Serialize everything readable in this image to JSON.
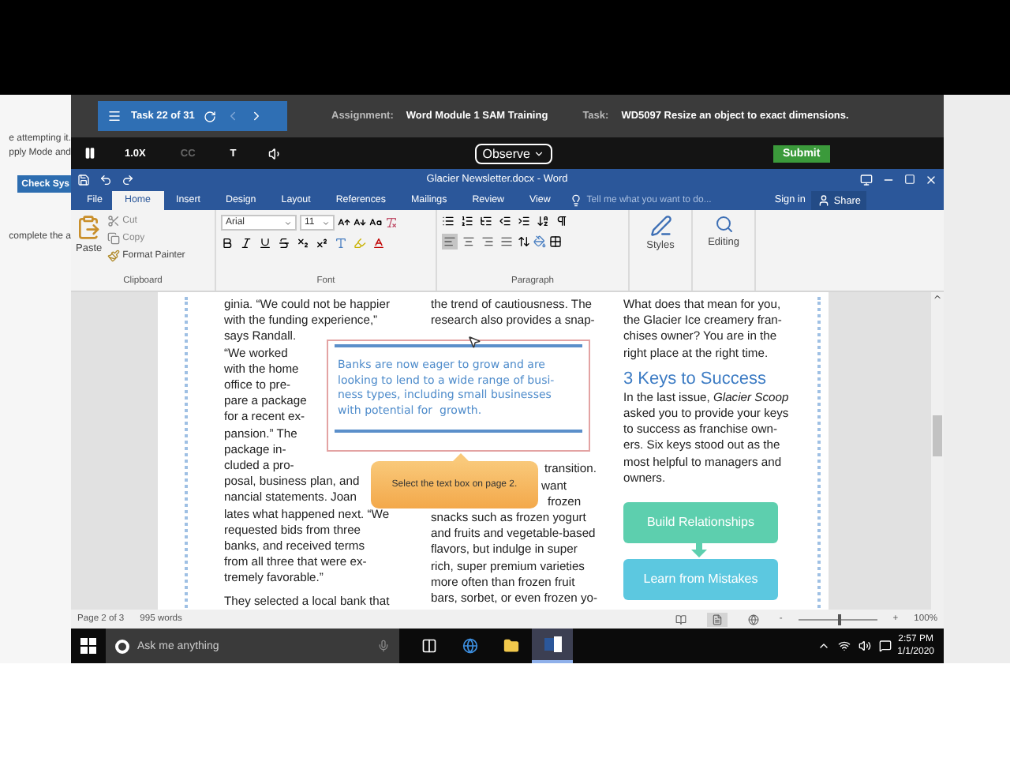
{
  "background_page": {
    "lines": [
      "e attempting it.",
      "pply Mode and"
    ],
    "button": "Check Sys",
    "note": "complete the a"
  },
  "sam_bar": {
    "task_counter": "Task 22 of 31",
    "prev_disabled": true,
    "next_disabled": false,
    "assignment_label": "Assignment:",
    "assignment": "Word Module 1 SAM Training",
    "task_label": "Task:",
    "task": "WD5097 Resize an object to exact dimensions."
  },
  "player": {
    "speed": "1.0X",
    "captions": {
      "label": "CC",
      "disabled": true
    },
    "text_toggle": "T",
    "mode": "Observe",
    "submit": "Submit"
  },
  "word": {
    "title": "Glacier Newsletter.docx - Word",
    "tabs": [
      {
        "label": "File",
        "selected": false
      },
      {
        "label": "Home",
        "selected": true
      },
      {
        "label": "Insert",
        "selected": false
      },
      {
        "label": "Design",
        "selected": false
      },
      {
        "label": "Layout",
        "selected": false
      },
      {
        "label": "References",
        "selected": false
      },
      {
        "label": "Mailings",
        "selected": false
      },
      {
        "label": "Review",
        "selected": false
      },
      {
        "label": "View",
        "selected": false
      }
    ],
    "tell_me": {
      "placeholder": "Tell me what you want to do..."
    },
    "sign_in": "Sign in",
    "share": "Share"
  },
  "ribbon": {
    "clipboard": {
      "paste": "Paste",
      "cut": "Cut",
      "copy": "Copy",
      "format_painter": "Format Painter",
      "label": "Clipboard"
    },
    "font": {
      "name": "Arial",
      "size": "11",
      "label": "Font"
    },
    "paragraph": {
      "label": "Paragraph",
      "alignments": [
        {
          "kind": "left",
          "selected": true
        },
        {
          "kind": "center",
          "selected": false
        },
        {
          "kind": "right",
          "selected": false
        },
        {
          "kind": "justify",
          "selected": false
        }
      ]
    },
    "styles": "Styles",
    "editing": "Editing"
  },
  "document": {
    "left_column": {
      "blocks": [
        [
          "ginia. “We could not be happier",
          "with the funding experience,”",
          "says Randall."
        ],
        [
          "“We worked",
          "with the home",
          "office to pre-",
          "pare a package",
          "for a recent ex-",
          "pansion.” The",
          "package in-",
          "cluded a pro-"
        ],
        [
          "posal, business plan, and",
          "nancial statements. Joan",
          "lates what happened next. “We",
          "requested bids from three",
          "banks, and received terms",
          "from all three that were ex-",
          "tremely favorable.”"
        ]
      ],
      "next": "They selected a local bank that"
    },
    "middle_column": {
      "lines": [
        "the trend of cautiousness. The",
        "research also provides a snap-"
      ],
      "fragments": [
        "transition.",
        "want",
        "frozen"
      ],
      "lines_after": [
        "snacks such as frozen yogurt",
        "and fruits and vegetable-based",
        "flavors, but indulge in super",
        "rich, super premium varieties",
        "more often than frozen fruit",
        "bars, sorbet, or even frozen yo-"
      ]
    },
    "right_column": {
      "lines": [
        "What does that mean for you,",
        "the Glacier Ice creamery fran-",
        "chises owner? You are in the",
        "right place at the right time."
      ],
      "heading": "3 Keys to Success",
      "body": [
        "In the last issue, *Glacier Scoop*",
        "asked you to provide your keys",
        "to success as franchise own-",
        "ers. Six keys stood out as the",
        "most helpful to managers and",
        "owners."
      ],
      "steps": [
        {
          "label": "Build Relationships",
          "color": "#5dcfae"
        },
        {
          "label": "Learn from Mistakes",
          "color": "#5cc8e0"
        }
      ]
    },
    "text_box": {
      "lines": [
        "Banks are now eager to grow and are",
        "looking to lend to a wide range of busi-",
        "ness types, including small businesses",
        "with potential for  growth."
      ]
    },
    "tooltip": "Select the text box on page 2."
  },
  "status_bar": {
    "page": "Page 2 of 3",
    "words": "995 words",
    "views": [
      {
        "kind": "read",
        "selected": false
      },
      {
        "kind": "print",
        "selected": true
      },
      {
        "kind": "web",
        "selected": false
      }
    ],
    "zoom": {
      "minus": "-",
      "plus": "+",
      "level": 0.5,
      "reading": "100%"
    }
  },
  "taskbar": {
    "search": {
      "placeholder": "Ask me anything"
    },
    "apps": [
      {
        "kind": "task-view",
        "active": false
      },
      {
        "kind": "edge",
        "active": false
      },
      {
        "kind": "explorer",
        "active": false
      },
      {
        "kind": "word",
        "active": true
      }
    ],
    "time": "2:57 PM",
    "date": "1/1/2020"
  }
}
